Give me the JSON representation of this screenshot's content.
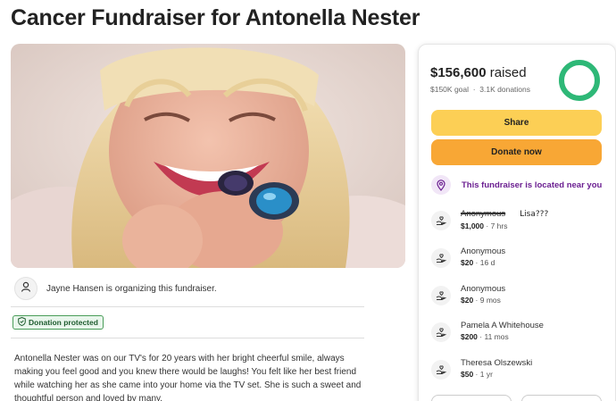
{
  "page": {
    "title": "Cancer Fundraiser for Antonella Nester",
    "organizer_text": "Jayne Hansen is organizing this fundraiser.",
    "badge_label": "Donation protected",
    "story": "Antonella Nester was on our TV's for 20 years with her bright cheerful smile, always making you feel good and you knew there would be laughs! You felt like her best friend while watching her as she came into your home via the TV set.  She is such a sweet and thoughtful person and loved by many."
  },
  "panel": {
    "raised_amount": "$156,600",
    "raised_suffix": "raised",
    "goal": "$150K goal",
    "donations_count": "3.1K donations",
    "progress_fraction": 1.0,
    "share_label": "Share",
    "donate_label": "Donate now",
    "location_text": "This fundraiser is located near you",
    "donations": [
      {
        "name": "Anonymous",
        "note": "Lisa???",
        "amount": "$1,000",
        "time": "7 hrs"
      },
      {
        "name": "Anonymous",
        "amount": "$20",
        "time": "16 d"
      },
      {
        "name": "Anonymous",
        "amount": "$20",
        "time": "9 mos"
      },
      {
        "name": "Pamela A Whitehouse",
        "amount": "$200",
        "time": "11 mos"
      },
      {
        "name": "Theresa Olszewski",
        "amount": "$50",
        "time": "1 yr"
      }
    ]
  },
  "colors": {
    "share": "#fccf55",
    "donate": "#f8a735",
    "progress": "#2eb877",
    "location": "#6b1f91",
    "badge_border": "#4a9d59"
  },
  "icons": [
    "person-icon",
    "shield-icon",
    "location-pin-icon",
    "donation-hand-icon"
  ]
}
